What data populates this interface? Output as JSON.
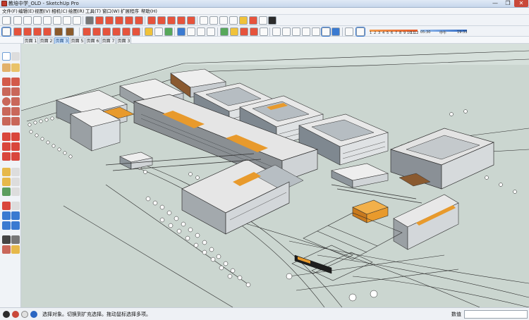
{
  "window": {
    "title": "教培中学_OLD - SketchUp Pro",
    "min_glyph": "—",
    "max_glyph": "❐",
    "close_glyph": "✕"
  },
  "menu": [
    {
      "label": "文件(F)"
    },
    {
      "label": "编辑(E)"
    },
    {
      "label": "视图(V)"
    },
    {
      "label": "相机(C)"
    },
    {
      "label": "绘图(R)"
    },
    {
      "label": "工具(T)"
    },
    {
      "label": "窗口(W)"
    },
    {
      "label": "扩展程序"
    },
    {
      "label": "帮助(H)"
    }
  ],
  "shadow": {
    "month_ticks": [
      "1",
      "2",
      "3",
      "4",
      "5",
      "6",
      "7",
      "8",
      "9",
      "10",
      "11",
      "12"
    ],
    "time_start": "05:30",
    "time_mid": "中午",
    "time_end": "19:33"
  },
  "scene_tabs": [
    {
      "label": "页面 1",
      "active": false
    },
    {
      "label": "页面 2",
      "active": false
    },
    {
      "label": "页面 3",
      "active": true
    },
    {
      "label": "页面 5",
      "active": false
    },
    {
      "label": "页面 6",
      "active": false
    },
    {
      "label": "页面 7",
      "active": false
    },
    {
      "label": "页面 3",
      "active": false
    }
  ],
  "status": {
    "text": "选择对象。切换到扩充选择。拖动鼠标选择多项。",
    "measurements_label": "数值",
    "measurements_value": ""
  },
  "colors": {
    "accent": "#e89a2c",
    "building_roof": "#e5e5e5",
    "ground": "#cdd8d2",
    "status_help": "#2b66c2"
  },
  "icons": [
    "select-icon",
    "eraser-icon",
    "paint-bucket-icon",
    "line-icon",
    "arc-icon",
    "rectangle-icon",
    "circle-icon",
    "polygon-icon",
    "push-pull-icon",
    "move-icon",
    "rotate-icon",
    "scale-icon",
    "offset-icon",
    "tape-measure-icon",
    "text-icon",
    "axes-icon",
    "orbit-icon",
    "pan-icon",
    "zoom-icon",
    "zoom-extents-icon",
    "walk-icon",
    "look-around-icon",
    "section-plane-icon"
  ]
}
